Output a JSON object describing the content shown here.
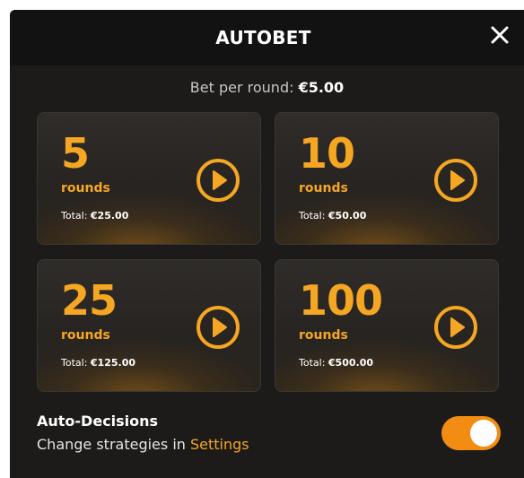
{
  "header": {
    "title": "AUTOBET"
  },
  "bet": {
    "label": "Bet per round:",
    "amount": "€5.00"
  },
  "options": [
    {
      "count": "5",
      "unit": "rounds",
      "total_label": "Total:",
      "total_value": "€25.00"
    },
    {
      "count": "10",
      "unit": "rounds",
      "total_label": "Total:",
      "total_value": "€50.00"
    },
    {
      "count": "25",
      "unit": "rounds",
      "total_label": "Total:",
      "total_value": "€125.00"
    },
    {
      "count": "100",
      "unit": "rounds",
      "total_label": "Total:",
      "total_value": "€500.00"
    }
  ],
  "auto_decisions": {
    "title": "Auto-Decisions",
    "subtitle_prefix": "Change strategies in",
    "settings_link": "Settings",
    "enabled": true
  },
  "colors": {
    "accent": "#f5a623",
    "toggle": "#f28c12",
    "panel": "#1c1b1a",
    "header": "#121212"
  },
  "icons": {
    "close": "close-icon",
    "play": "play-icon"
  }
}
